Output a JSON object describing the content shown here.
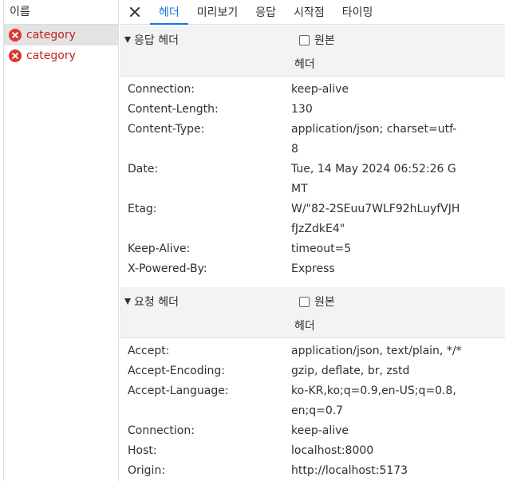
{
  "left_panel": {
    "header": "이름",
    "requests": [
      {
        "name": "category",
        "status": "error",
        "selected": true
      },
      {
        "name": "category",
        "status": "error",
        "selected": false
      }
    ]
  },
  "tabs": [
    {
      "label": "헤더",
      "active": true
    },
    {
      "label": "미리보기",
      "active": false
    },
    {
      "label": "응답",
      "active": false
    },
    {
      "label": "시작점",
      "active": false
    },
    {
      "label": "타이밍",
      "active": false
    }
  ],
  "response_section": {
    "title": "응답 헤더",
    "raw_label": "원본",
    "sub_label": "헤더",
    "headers": [
      {
        "key": "Connection:",
        "value": "keep-alive"
      },
      {
        "key": "Content-Length:",
        "value": "130"
      },
      {
        "key": "Content-Type:",
        "value": "application/json; charset=utf-8"
      },
      {
        "key": "Date:",
        "value": "Tue, 14 May 2024 06:52:26 GMT"
      },
      {
        "key": "Etag:",
        "value": "W/\"82-2SEuu7WLF92hLuyfVJHfJzZdkE4\""
      },
      {
        "key": "Keep-Alive:",
        "value": "timeout=5"
      },
      {
        "key": "X-Powered-By:",
        "value": "Express"
      }
    ]
  },
  "request_section": {
    "title": "요청 헤더",
    "raw_label": "원본",
    "sub_label": "헤더",
    "headers": [
      {
        "key": "Accept:",
        "value": "application/json, text/plain, */*"
      },
      {
        "key": "Accept-Encoding:",
        "value": "gzip, deflate, br, zstd"
      },
      {
        "key": "Accept-Language:",
        "value": "ko-KR,ko;q=0.9,en-US;q=0.8,en;q=0.7"
      },
      {
        "key": "Connection:",
        "value": "keep-alive"
      },
      {
        "key": "Host:",
        "value": "localhost:8000"
      },
      {
        "key": "Origin:",
        "value": "http://localhost:5173"
      }
    ]
  },
  "colors": {
    "accent": "#1a73e8",
    "error": "#dc362e",
    "error_text": "#c5221f",
    "section_bg": "#f1f3f4",
    "selected_bg": "#e3e3e3"
  }
}
